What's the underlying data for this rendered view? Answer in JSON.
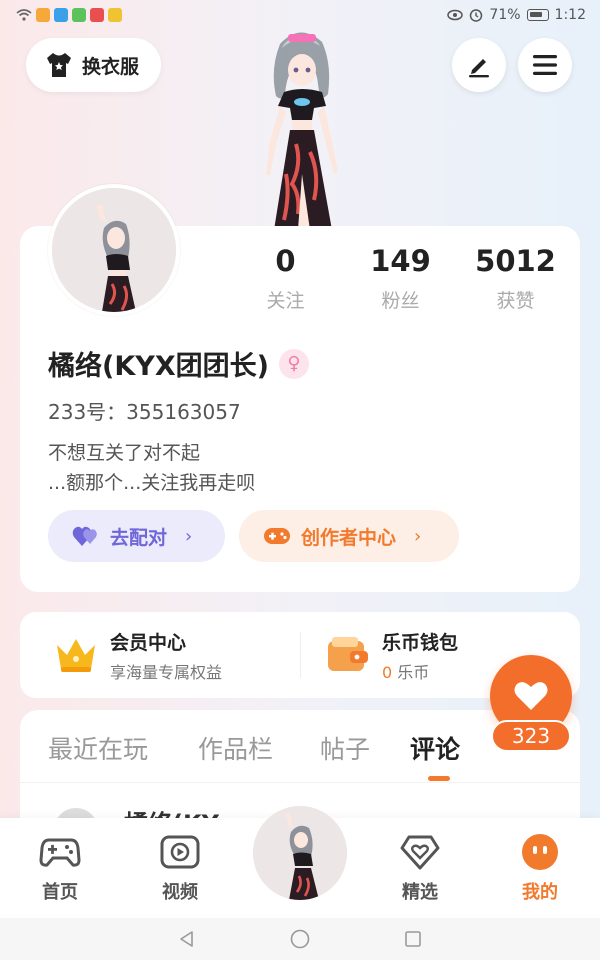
{
  "status_bar": {
    "battery": "71%",
    "time": "1:12"
  },
  "header": {
    "wardrobe_label": "换衣服"
  },
  "profile": {
    "stats": [
      {
        "value": "0",
        "label": "关注"
      },
      {
        "value": "149",
        "label": "粉丝"
      },
      {
        "value": "5012",
        "label": "获赞"
      }
    ],
    "username": "橘络(KYX团团长)",
    "gender_symbol": "♀",
    "uid": "233号：355163057",
    "bio_line1": "不想互关了对不起",
    "bio_line2": "...额那个...关注我再走呗",
    "match_label": "去配对",
    "creator_label": "创作者中心"
  },
  "member": {
    "vip_title": "会员中心",
    "vip_sub": "享海量专属权益",
    "wallet_title": "乐币钱包",
    "wallet_amount": "0",
    "wallet_unit": "乐币"
  },
  "tabs": [
    "最近在玩",
    "作品栏",
    "帖子",
    "评论"
  ],
  "active_tab": "评论",
  "comment_peek": "橘络(KY",
  "like_count": "323",
  "bottom_nav": {
    "items": [
      "首页",
      "视频",
      "精选",
      "我的"
    ],
    "active": "我的"
  },
  "colors": {
    "accent": "#f27a2c",
    "match": "#6e66d9"
  }
}
